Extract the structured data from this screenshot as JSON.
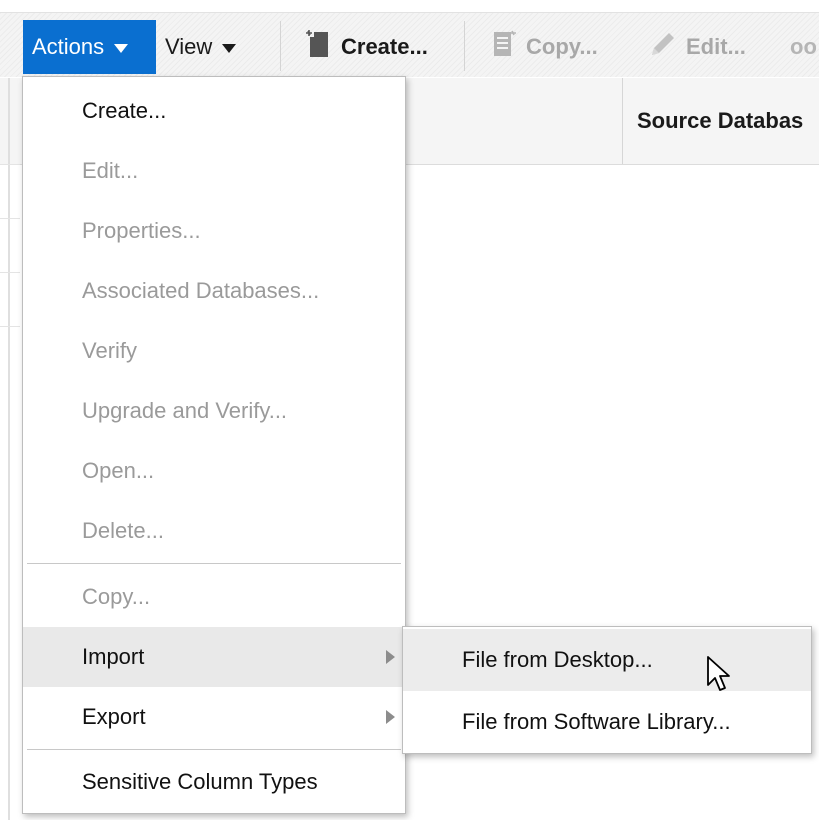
{
  "toolbar": {
    "actions_label": "Actions",
    "view_label": "View",
    "create_label": "Create...",
    "copy_label": "Copy...",
    "edit_label": "Edit...",
    "more_glyph": "oo"
  },
  "table": {
    "column_header": "Source Databas"
  },
  "menu": {
    "items": [
      {
        "label": "Create...",
        "enabled": true
      },
      {
        "label": "Edit...",
        "enabled": false
      },
      {
        "label": "Properties...",
        "enabled": false
      },
      {
        "label": "Associated Databases...",
        "enabled": false
      },
      {
        "label": "Verify",
        "enabled": false
      },
      {
        "label": "Upgrade and Verify...",
        "enabled": false
      },
      {
        "label": "Open...",
        "enabled": false
      },
      {
        "label": "Delete...",
        "enabled": false
      },
      {
        "label": "Copy...",
        "enabled": false
      },
      {
        "label": "Import",
        "enabled": true,
        "submenu": true
      },
      {
        "label": "Export",
        "enabled": true,
        "submenu": true
      },
      {
        "label": "Sensitive Column Types",
        "enabled": true
      }
    ]
  },
  "submenu": {
    "items": [
      {
        "label": "File from Desktop..."
      },
      {
        "label": "File from Software Library..."
      }
    ]
  },
  "colors": {
    "accent": "#0a6fd0",
    "disabled_text": "#9a9a9a",
    "active_item": "#e9e9e9"
  },
  "icons": {
    "create": "new-document-icon",
    "copy": "copy-document-icon",
    "edit": "pencil-icon",
    "submenu": "submenu-arrow-icon",
    "cursor": "mouse-pointer-icon"
  }
}
